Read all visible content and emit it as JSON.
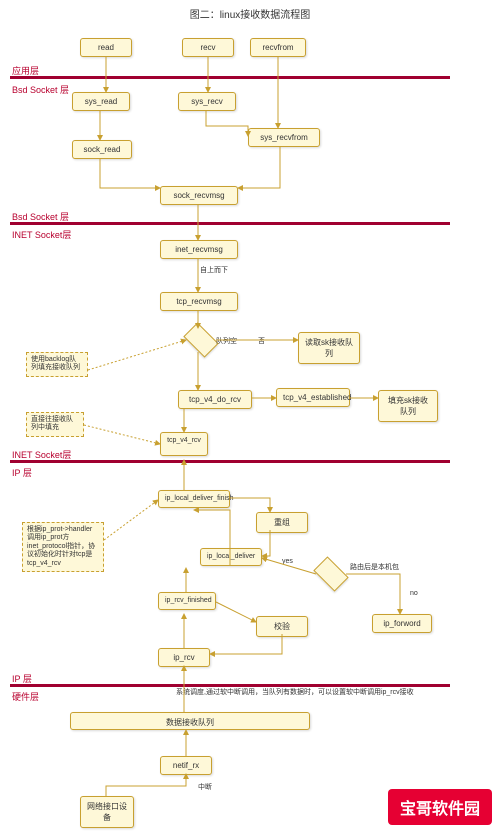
{
  "title": "图二：linux接收数据流程图",
  "layers": {
    "app": "应用层",
    "bsd1": "Bsd Socket 层",
    "bsd2": "Bsd Socket 层",
    "inet1": "INET Socket层",
    "inet2": "INET Socket层",
    "ip1": "IP 层",
    "ip2": "IP 层",
    "hw": "硬件层"
  },
  "nodes": {
    "read": "read",
    "recv": "recv",
    "recvfrom": "recvfrom",
    "sys_read": "sys_read",
    "sys_recv": "sys_recv",
    "sys_recvfrom": "sys_recvfrom",
    "sock_read": "sock_read",
    "sock_recvmsg": "sock_recvmsg",
    "inet_recvmsg": "inet_recvmsg",
    "tcp_recvmsg": "tcp_recvmsg",
    "read_sk_queue": "读取sk接收队列",
    "tcp_v4_do_rcv": "tcp_v4_do_rcv",
    "tcp_v4_established": "tcp_v4_established",
    "fill_sk_queue": "填充sk接收队列",
    "tcp_v4_rcv": "tcp_v4_rcv",
    "ip_local_deliver_finish": "ip_local_deliver_finish",
    "reassemble": "重组",
    "ip_local_deliver": "ip_local_deliver",
    "ip_rcv_finished": "ip_rcv_finished",
    "checksum": "校验",
    "ip_forward": "ip_forword",
    "ip_rcv": "ip_rcv",
    "rx_queue": "数据接收队列",
    "netif_rx": "netif_rx",
    "nic": "网络接口设备"
  },
  "notes": {
    "backlog": "使用backlog队列填充接收队列",
    "direct_fill": "直接往接收队列中填充",
    "ip_prot": "根据ip_prot->handler调用ip_prot方inet_protocol指针，协议初始化时针对tcp是tcp_v4_rcv"
  },
  "annotations": {
    "top_down": "自上而下",
    "queue_empty": "队列空",
    "no": "否",
    "yes": "yes",
    "no2": "no",
    "route_local": "路由后是本机包",
    "softirq": "系统调度,通过软中断调用，当队列有数据时，可以设置软中断调用ip_rcv接收",
    "interrupt": "中断"
  },
  "watermark": "宝哥软件园"
}
